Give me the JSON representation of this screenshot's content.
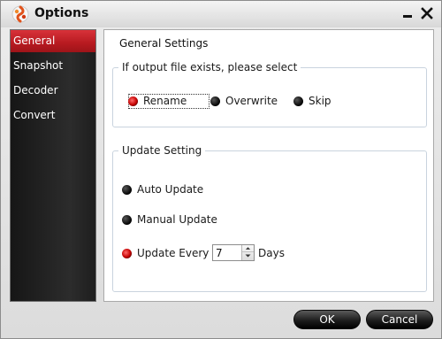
{
  "window": {
    "title": "Options"
  },
  "sidebar": {
    "items": [
      {
        "label": "General",
        "active": true
      },
      {
        "label": "Snapshot",
        "active": false
      },
      {
        "label": "Decoder",
        "active": false
      },
      {
        "label": "Convert",
        "active": false
      }
    ]
  },
  "panel": {
    "title": "General Settings",
    "output_group": {
      "legend": "If output file exists, please select",
      "options": [
        {
          "label": "Rename",
          "selected": true
        },
        {
          "label": "Overwrite",
          "selected": false
        },
        {
          "label": "Skip",
          "selected": false
        }
      ]
    },
    "update_group": {
      "legend": "Update Setting",
      "options": [
        {
          "label": "Auto Update",
          "selected": false
        },
        {
          "label": "Manual Update",
          "selected": false
        },
        {
          "label": "Update Every",
          "selected": true
        }
      ],
      "interval_value": "7",
      "interval_unit": "Days"
    }
  },
  "footer": {
    "ok_label": "OK",
    "cancel_label": "Cancel"
  },
  "colors": {
    "accent": "#c8242b",
    "radio_selected": "#e01010",
    "sidebar_bg": "#1e1e1e"
  }
}
